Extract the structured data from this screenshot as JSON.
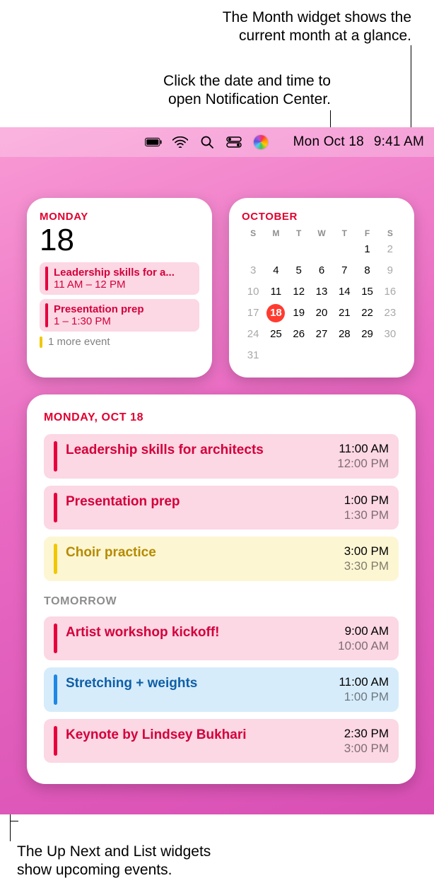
{
  "callouts": {
    "month_line1": "The Month widget shows the",
    "month_line2": "current month at a glance.",
    "datetime_line1": "Click the date and time to",
    "datetime_line2": "open Notification Center.",
    "upnext_line1": "The Up Next and List widgets",
    "upnext_line2": "show upcoming events."
  },
  "menubar": {
    "date": "Mon Oct 18",
    "time": "9:41 AM"
  },
  "upnext": {
    "day_label": "MONDAY",
    "day_number": "18",
    "events": [
      {
        "title": "Leadership skills for a...",
        "time": "11 AM – 12 PM",
        "color_bg": "#fcd7e4",
        "color_bar": "#e6003d",
        "color_text": "#d3003b"
      },
      {
        "title": "Presentation prep",
        "time": "1 – 1:30 PM",
        "color_bg": "#fcd7e4",
        "color_bar": "#e6003d",
        "color_text": "#d3003b"
      }
    ],
    "more_label": "1 more event",
    "more_bar": "#f0c800"
  },
  "month": {
    "label": "OCTOBER",
    "weekdays": [
      "S",
      "M",
      "T",
      "W",
      "T",
      "F",
      "S"
    ],
    "lead_blank": 5,
    "days": 31,
    "today": 18,
    "weekend_cols": [
      0,
      6
    ]
  },
  "list": {
    "date_label": "MONDAY, OCT 18",
    "today": [
      {
        "title": "Leadership skills for architects",
        "start": "11:00 AM",
        "end": "12:00 PM",
        "bg": "#fcd7e4",
        "bar": "#e6003d",
        "text": "#d3003b"
      },
      {
        "title": "Presentation prep",
        "start": "1:00 PM",
        "end": "1:30 PM",
        "bg": "#fcd7e4",
        "bar": "#e6003d",
        "text": "#d3003b"
      },
      {
        "title": "Choir practice",
        "start": "3:00 PM",
        "end": "3:30 PM",
        "bg": "#fdf6d3",
        "bar": "#f0c800",
        "text": "#b58b00"
      }
    ],
    "sub_label": "TOMORROW",
    "tomorrow": [
      {
        "title": "Artist workshop kickoff!",
        "start": "9:00 AM",
        "end": "10:00 AM",
        "bg": "#fcd7e4",
        "bar": "#e6003d",
        "text": "#d3003b"
      },
      {
        "title": "Stretching + weights",
        "start": "11:00 AM",
        "end": "1:00 PM",
        "bg": "#d6ecfb",
        "bar": "#1e88e5",
        "text": "#0f5fa6"
      },
      {
        "title": "Keynote by Lindsey Bukhari",
        "start": "2:30 PM",
        "end": "3:00 PM",
        "bg": "#fcd7e4",
        "bar": "#e6003d",
        "text": "#d3003b"
      }
    ]
  }
}
